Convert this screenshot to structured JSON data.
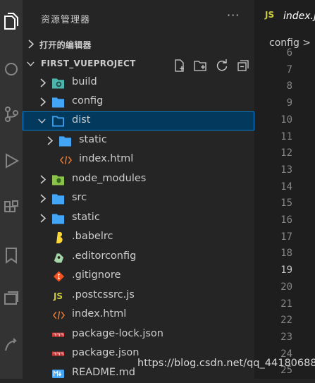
{
  "sidebar": {
    "title": "资源管理器",
    "more": "···",
    "open_editors": "打开的编辑器",
    "project": "FIRST_VUEPROJECT",
    "tree": [
      {
        "label": "build",
        "icon": "folder-gear-icon"
      },
      {
        "label": "config",
        "icon": "folder-icon"
      },
      {
        "label": "dist",
        "icon": "folder-icon",
        "selected": true
      },
      {
        "label": "static",
        "icon": "folder-icon"
      },
      {
        "label": "index.html",
        "icon": "html-icon"
      },
      {
        "label": "node_modules",
        "icon": "folder-node-icon"
      },
      {
        "label": "src",
        "icon": "folder-icon"
      },
      {
        "label": "static",
        "icon": "folder-icon"
      },
      {
        "label": ".babelrc",
        "icon": "babel-icon"
      },
      {
        "label": ".editorconfig",
        "icon": "editorconfig-icon"
      },
      {
        "label": ".gitignore",
        "icon": "git-icon"
      },
      {
        "label": ".postcssrc.js",
        "icon": "js-icon"
      },
      {
        "label": "index.html",
        "icon": "html-icon"
      },
      {
        "label": "package-lock.json",
        "icon": "npm-icon"
      },
      {
        "label": "package.json",
        "icon": "npm-icon"
      },
      {
        "label": "README.md",
        "icon": "markdown-icon"
      }
    ]
  },
  "editor": {
    "tab_badge": "JS",
    "tab_label": "index.j",
    "breadcrumb": "config >",
    "line_numbers": [
      "6",
      "7",
      "8",
      "9",
      "10",
      "11",
      "12",
      "13",
      "14",
      "15",
      "16",
      "17",
      "18",
      "19",
      "20",
      "21",
      "22",
      "23",
      "24",
      "25"
    ],
    "active_line": "19"
  },
  "watermark": "https://blog.csdn.net/qq_44180688",
  "colors": {
    "folder": "#42a5f5",
    "selection": "#04395e",
    "js": "#cbcb41",
    "npm": "#cb3837",
    "git": "#f4511e",
    "html": "#e37933"
  }
}
